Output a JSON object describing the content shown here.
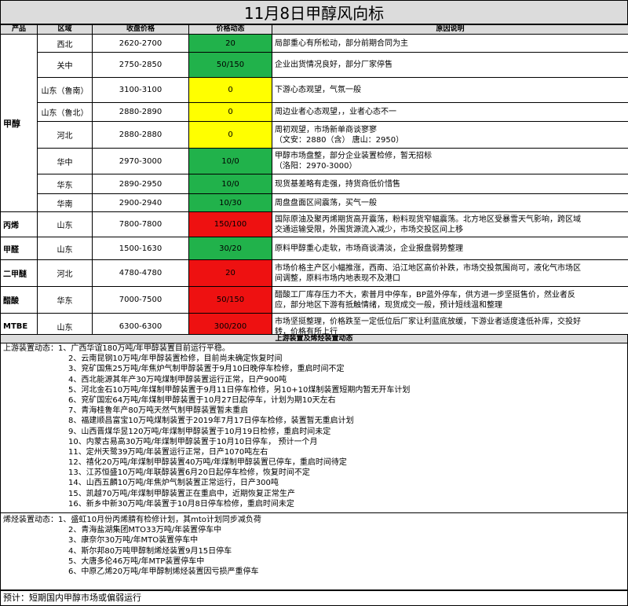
{
  "title": "11月8日甲醇风向标",
  "headers": [
    "产品",
    "区域",
    "收盘价格",
    "价格动态",
    "原因说明"
  ],
  "rows": [
    {
      "product": "甲醇",
      "region": "西北",
      "price": "2620-2700",
      "move": "20",
      "color": "green",
      "reason": [
        "局部重心有所松动，部分前期合同为主"
      ]
    },
    {
      "product": "",
      "region": "关中",
      "price": "2750-2850",
      "move": "50/150",
      "color": "green",
      "reason": [
        "企业出货情况良好，部分厂家停售"
      ]
    },
    {
      "product": "",
      "region": "山东（鲁南）",
      "price": "3100-3100",
      "move": "0",
      "color": "yellow",
      "reason": [
        "下游心态观望，气氛一般"
      ]
    },
    {
      "product": "",
      "region": "山东（鲁北）",
      "price": "2880-2890",
      "move": "0",
      "color": "yellow",
      "reason": [
        "周边业者心态观望，，业者心态不一"
      ]
    },
    {
      "product": "",
      "region": "河北",
      "price": "2880-2880",
      "move": "0",
      "color": "yellow",
      "reason": [
        "周初观望，市场新单商谈寥寥",
        "（文安：2880（含） 唐山：2950）"
      ]
    },
    {
      "product": "",
      "region": "华中",
      "price": "2970-3000",
      "move": "10/0",
      "color": "green",
      "reason": [
        "甲醇市场盘整，部分企业装置检修，暂无招标",
        "（洛阳：2970-3000）"
      ]
    },
    {
      "product": "",
      "region": "华东",
      "price": "2890-2950",
      "move": "10/0",
      "color": "green",
      "reason": [
        "现货基差略有走强，持货商低价惜售"
      ]
    },
    {
      "product": "",
      "region": "华南",
      "price": "2900-2940",
      "move": "10/30",
      "color": "green",
      "reason": [
        "周盘盘面区间震荡，买气一般"
      ]
    },
    {
      "product": "丙烯",
      "region": "山东",
      "price": "7800-7800",
      "move": "150/100",
      "color": "red",
      "reason": [
        "国际原油及聚丙烯期货高开震荡，粉料现货窄幅震荡。北方地区受暴雪天气影响，跨区域",
        "交通运输受限，外围货源流入减少，市场交投区间上移"
      ]
    },
    {
      "product": "甲醛",
      "region": "山东",
      "price": "1500-1630",
      "move": "30/20",
      "color": "green",
      "reason": [
        "原料甲醇重心走软，市场商谈清淡，企业报盘弱势整理"
      ]
    },
    {
      "product": "二甲醚",
      "region": "河北",
      "price": "4780-4780",
      "move": "20",
      "color": "red",
      "reason": [
        "市场价格主产区小幅推涨，西南、沿江地区高价补跌，市场交投氛围尚可，液化气市场区",
        "间调整，原料市场内地表现不及港口"
      ]
    },
    {
      "product": "醋酸",
      "region": "华东",
      "price": "7000-7500",
      "move": "50/150",
      "color": "red",
      "reason": [
        "醋酸工厂库存压力不大，索普月中停车，BP蓝外停车，供方进一步坚挺售价，然业者反",
        "应，部分地区下游有抵触情绪，现货成交一般，预计短线温和整理"
      ]
    },
    {
      "product": "MTBE",
      "region": "山东",
      "price": "6300-6300",
      "move": "300/200",
      "color": "red",
      "reason": [
        "市场坚挺整理，价格跌至一定低位后厂家让利蓝底放缓，下游业者适度逢低补库，交投好",
        "转，价格有所上行"
      ]
    }
  ],
  "upstream": {
    "section_title": "上游装置及烯烃装置动态",
    "lead": "上游装置动态：",
    "items": [
      "1、广西华谊180万吨/年甲醇装置目前运行平稳。",
      "2、云南昆钢10万吨/年甲醇装置检修，目前尚未确定恢复时间",
      "3、兖矿国焦25万吨/年焦炉气制甲醇装置于9月10日晚停车检修，重启时间不定",
      "4、西北能源其年产30万吨煤制甲醇装置运行正常，日产900吨",
      "5、河北金石10万吨/年煤制甲醇装置于9月11日停车检修，另10+10煤制装置短期内暂无开车计划",
      "6、兖矿国宏64万吨/年煤制甲醇装置于10月27日起停车，计划为期10天左右",
      "7、青海桂鲁年产80万吨天然气制甲醇装置暂未重启",
      "8、福建顺昌富宝10万吨煤制装置于2019年7月17日停车检修，装置暂无重启计划",
      "9、山西晋煤华昱120万吨/年煤制甲醇装置于10月19日检修，重启时间未定",
      "10、内蒙古易高30万吨/年煤制甲醇装置于10月10日停车， 预计一个月",
      "11、定州天鹭39万吨/年装置运行正常，日产1070吨左右",
      "12、禧化20万吨/年煤制甲醇装置40万吨/年煤制甲醇装置已停车，重启时间待定",
      "13、江苏恒盛10万吨/年联醇装置6月20日起停车检修，恢复时间不定",
      "14、山西五麟10万吨/年焦炉气制装置正常运行，日产300吨",
      "15、凯越70万吨/年煤制甲醇装置正在重启中，近期恢复正常生产",
      "16、新乡中新30万吨/年装置于10月8日停车检修，重启时间未定"
    ]
  },
  "olefin": {
    "lead": "烯烃装置动态：",
    "items": [
      "1、盛虹10月份丙烯腈有检修计划，其mto计划同步减负荷",
      "2、青海盐湖集团MTO33万吨/年装置停车中",
      "3、康奈尔30万吨/年MTO装置停车中",
      "4、斯尔邦80万吨甲醇制烯烃装置9月15日停车",
      "5、大唐多伦46万吨/年MTP装置停车中",
      "6、中原乙烯20万吨/年甲醇制烯烃装置因亏损严重停车"
    ]
  },
  "forecast": "预计：短期国内甲醇市场或偏弱运行",
  "colors": {
    "green": "#21b24b",
    "yellow": "#ffff00",
    "red": "#ee1111",
    "header_gray": "#dcdcdc"
  }
}
